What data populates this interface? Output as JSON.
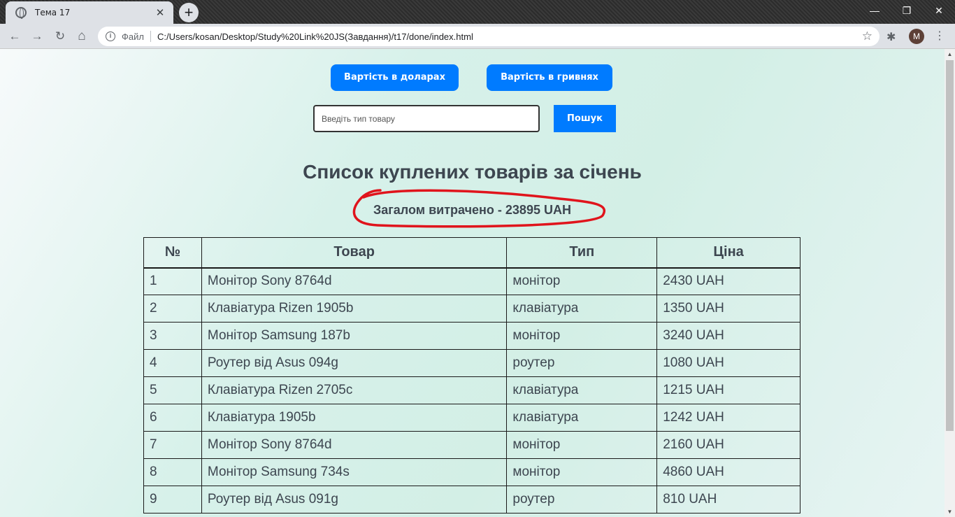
{
  "browser": {
    "tab_title": "Тема 17",
    "close_symbol": "✕",
    "new_tab_symbol": "+",
    "scheme_label": "Файл",
    "url": "C:/Users/kosan/Desktop/Study%20Link%20JS(Завдання)/t17/done/index.html",
    "profile_initial": "M",
    "controls": {
      "back": "←",
      "forward": "→",
      "reload": "↻",
      "home": "⌂",
      "star": "☆",
      "extensions": "✱",
      "menu": "⋮",
      "minimize": "—",
      "restore": "❐",
      "close": "✕"
    }
  },
  "page": {
    "usd_button": "Вартість в доларах",
    "uah_button": "Вартість в гривнях",
    "search_placeholder": "Введіть тип товару",
    "search_button": "Пошук",
    "title": "Список куплених товарів за січень",
    "total": "Загалом витрачено - 23895 UAH",
    "annotation_color": "#e0141c",
    "accent_color": "#007bff"
  },
  "table": {
    "headers": [
      "№",
      "Товар",
      "Тип",
      "Ціна"
    ],
    "rows": [
      [
        "1",
        "Монітор Sony 8764d",
        "монітор",
        "2430 UAH"
      ],
      [
        "2",
        "Клавіатура Rizen 1905b",
        "клавіатура",
        "1350 UAH"
      ],
      [
        "3",
        "Монітор Samsung 187b",
        "монітор",
        "3240 UAH"
      ],
      [
        "4",
        "Роутер від Asus 094g",
        "роутер",
        "1080 UAH"
      ],
      [
        "5",
        "Клавіатура Rizen 2705c",
        "клавіатура",
        "1215 UAH"
      ],
      [
        "6",
        "Клавіатура 1905b",
        "клавіатура",
        "1242 UAH"
      ],
      [
        "7",
        "Монітор Sony 8764d",
        "монітор",
        "2160 UAH"
      ],
      [
        "8",
        "Монітор Samsung 734s",
        "монітор",
        "4860 UAH"
      ],
      [
        "9",
        "Роутер від Asus 091g",
        "роутер",
        "810 UAH"
      ]
    ]
  }
}
